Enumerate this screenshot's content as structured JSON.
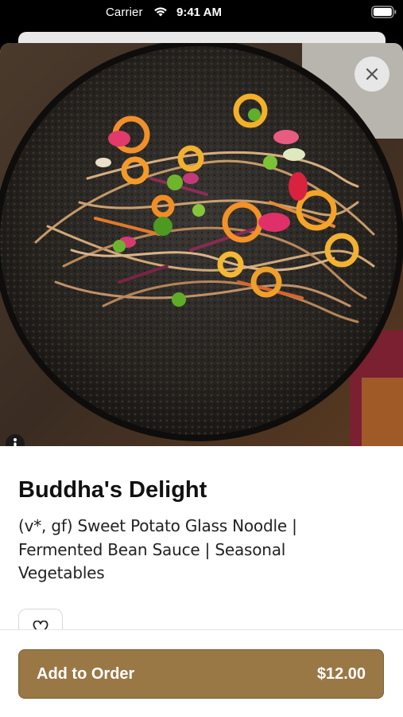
{
  "status_bar": {
    "carrier": "Carrier",
    "time": "9:41 AM",
    "icons": [
      "wifi-icon",
      "battery-icon"
    ]
  },
  "item": {
    "title": "Buddha's Delight",
    "description_lines": [
      "(v*, gf) Sweet Potato Glass Noodle |",
      "Fermented Bean Sauce | Seasonal",
      "Vegetables"
    ]
  },
  "hero": {
    "image": "noodle-bowl-photo",
    "icons": [
      "close-icon",
      "info-icon"
    ]
  },
  "actions": {
    "favorite_icon": "heart-icon",
    "add_to_order_label": "Add to Order",
    "price": "$12.00"
  },
  "colors": {
    "accent": "#9a7846",
    "accent_border": "#7d5f34",
    "text": "#111111",
    "background": "#ffffff"
  }
}
